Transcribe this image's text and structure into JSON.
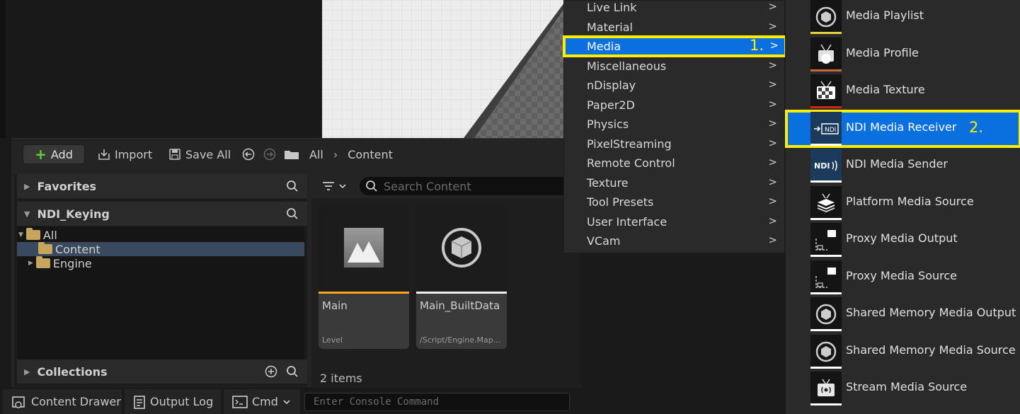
{
  "toolbar": {
    "add_label": "Add",
    "import_label": "Import",
    "save_all_label": "Save All",
    "path": [
      "All",
      "Content"
    ]
  },
  "left_panel": {
    "favorites_label": "Favorites",
    "project_label": "NDI_Keying",
    "tree": [
      {
        "label": "All"
      },
      {
        "label": "Content",
        "selected": true
      },
      {
        "label": "Engine"
      }
    ],
    "collections_label": "Collections"
  },
  "content": {
    "search_placeholder": "Search Content",
    "items": [
      {
        "name": "Main",
        "type": "Level",
        "bar_color": "#f5a623"
      },
      {
        "name": "Main_BuiltData",
        "type": "/Script/Engine.Map...",
        "bar_color": "#f0f0f0"
      }
    ],
    "count_label": "2 items"
  },
  "statusbar": {
    "content_drawer": "Content Drawer",
    "output_log": "Output Log",
    "cmd": "Cmd",
    "console_placeholder": "Enter Console Command"
  },
  "category_menu": {
    "items": [
      "Live Link",
      "Material",
      "Media",
      "Miscellaneous",
      "nDisplay",
      "Paper2D",
      "Physics",
      "PixelStreaming",
      "Remote Control",
      "Texture",
      "Tool Presets",
      "User Interface",
      "VCam"
    ],
    "selected": "Media",
    "annotation": "1."
  },
  "sub_menu": {
    "items": [
      {
        "label": "Media Playlist",
        "icon": "media-playlist-icon",
        "accent": "#e6d23a"
      },
      {
        "label": "Media Profile",
        "icon": "media-profile-icon",
        "accent": "#c46a3a"
      },
      {
        "label": "Media Texture",
        "icon": "media-texture-icon",
        "accent": "#d02020"
      },
      {
        "label": "NDI Media Receiver",
        "icon": "ndi-receiver-icon",
        "accent": "#ffffff",
        "selected": true
      },
      {
        "label": "NDI Media Sender",
        "icon": "ndi-sender-icon",
        "accent": "#ffffff"
      },
      {
        "label": "Platform Media Source",
        "icon": "platform-media-source-icon",
        "accent": "#ffffff"
      },
      {
        "label": "Proxy Media Output",
        "icon": "proxy-media-output-icon",
        "accent": "#ffffff"
      },
      {
        "label": "Proxy Media Source",
        "icon": "proxy-media-source-icon",
        "accent": "#ffffff"
      },
      {
        "label": "Shared Memory Media Output",
        "icon": "shared-memory-output-icon",
        "accent": "#ffffff"
      },
      {
        "label": "Shared Memory Media Source",
        "icon": "shared-memory-source-icon",
        "accent": "#ffffff"
      },
      {
        "label": "Stream Media Source",
        "icon": "stream-media-source-icon",
        "accent": "#ffffff"
      }
    ],
    "annotation": "2."
  }
}
